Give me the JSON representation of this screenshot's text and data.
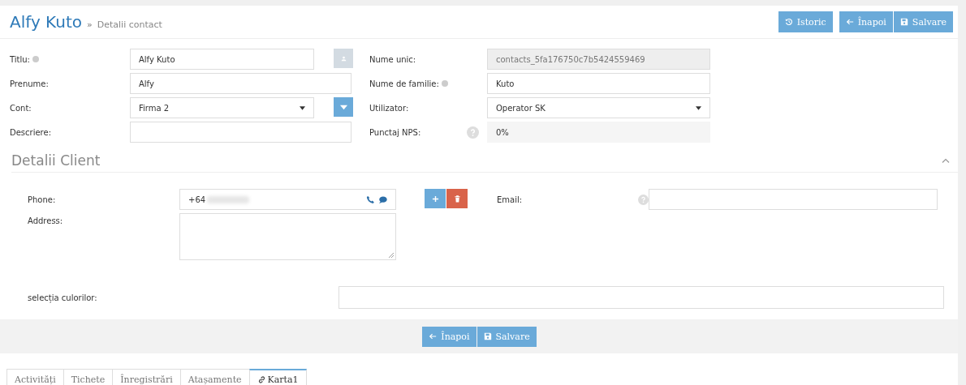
{
  "header": {
    "title": "Alfy Kuto",
    "separator": "»",
    "subtitle": "Detalii contact"
  },
  "header_buttons": [
    {
      "kind": "history",
      "label": "Istoric"
    },
    {
      "kind": "back",
      "label": "Înapoi"
    },
    {
      "kind": "save",
      "label": "Salvare"
    }
  ],
  "form_left": [
    {
      "label": "Titlu:",
      "info": true,
      "kind": "text",
      "value": "Alfy Kuto",
      "contact_button": true
    },
    {
      "label": "Prenume:",
      "kind": "text",
      "value": "Alfy"
    },
    {
      "label": "Cont:",
      "kind": "select",
      "value": "Firma 2",
      "dropdown_button": true
    },
    {
      "label": "Descriere:",
      "kind": "text"
    }
  ],
  "form_right": [
    {
      "label": "Nume unic:",
      "kind": "readonly",
      "disabled": true,
      "value": "contacts_5fa176750c7b5424559469"
    },
    {
      "label": "Nume de familie:",
      "info": true,
      "kind": "text",
      "value": "Kuto"
    },
    {
      "label": "Utilizator:",
      "kind": "select",
      "value": "Operator SK"
    },
    {
      "label": "Punctaj NPS:",
      "help": true,
      "kind": "score",
      "value": "0%"
    }
  ],
  "client_section": {
    "title": "Detalii Client",
    "expanded": true,
    "phone": {
      "label": "Phone:",
      "value": "+64",
      "redacted": true
    },
    "email": {
      "label": "Email:",
      "help": true
    },
    "address": {
      "label": "Address:"
    },
    "color_selection": {
      "label": "selecția culorilor:"
    }
  },
  "footer_buttons": [
    {
      "kind": "back",
      "label": "Înapoi"
    },
    {
      "kind": "save",
      "label": "Salvare"
    }
  ],
  "tabs": [
    {
      "label": "Activități",
      "selected": false
    },
    {
      "label": "Tichete",
      "selected": false
    },
    {
      "label": "Înregistrări",
      "selected": false
    },
    {
      "label": "Atașamente",
      "selected": false
    },
    {
      "label": "Karta1",
      "selected": true,
      "kind": "link"
    }
  ]
}
